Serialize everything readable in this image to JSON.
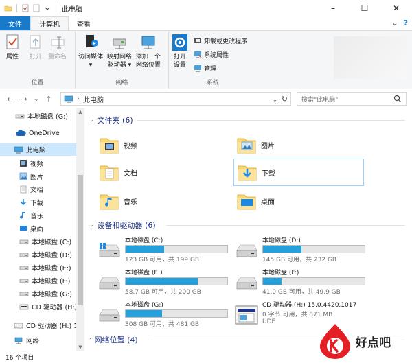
{
  "window": {
    "title": "此电脑"
  },
  "tabs": [
    {
      "label": "文件"
    },
    {
      "label": "计算机"
    },
    {
      "label": "查看"
    }
  ],
  "ribbon": {
    "location": {
      "label": "位置",
      "properties": "属性",
      "open": "打开",
      "rename": "重命名"
    },
    "network": {
      "label": "网络",
      "access_media_1": "访问媒体",
      "access_media_2": "",
      "map_drive_1": "映射网络",
      "map_drive_2": "驱动器",
      "add_location_1": "添加一个",
      "add_location_2": "网络位置"
    },
    "system": {
      "label": "系统",
      "open_settings_1": "打开",
      "open_settings_2": "设置",
      "uninstall": "卸载或更改程序",
      "sys_props": "系统属性",
      "manage": "管理"
    }
  },
  "address": {
    "path": "此电脑",
    "search_placeholder": "搜索\"此电脑\""
  },
  "nav": {
    "items": [
      {
        "label": "本地磁盘 (G:)",
        "icon": "drive-icon"
      },
      {
        "label": "OneDrive",
        "icon": "cloud-icon"
      },
      {
        "label": "此电脑",
        "icon": "computer-icon"
      },
      {
        "label": "视频",
        "icon": "video-icon"
      },
      {
        "label": "图片",
        "icon": "pictures-icon"
      },
      {
        "label": "文档",
        "icon": "document-icon"
      },
      {
        "label": "下载",
        "icon": "download-icon"
      },
      {
        "label": "音乐",
        "icon": "music-icon"
      },
      {
        "label": "桌面",
        "icon": "desktop-icon"
      },
      {
        "label": "本地磁盘 (C:)",
        "icon": "drive-icon"
      },
      {
        "label": "本地磁盘 (D:)",
        "icon": "drive-icon"
      },
      {
        "label": "本地磁盘 (E:)",
        "icon": "drive-icon"
      },
      {
        "label": "本地磁盘 (F:)",
        "icon": "drive-icon"
      },
      {
        "label": "本地磁盘 (G:)",
        "icon": "drive-icon"
      },
      {
        "label": "CD 驱动器 (H:)",
        "icon": "cd-icon"
      },
      {
        "label": "CD 驱动器 (H:) 1!",
        "icon": "cd-icon"
      },
      {
        "label": "网络",
        "icon": "network-icon"
      }
    ]
  },
  "content": {
    "folders_header": "文件夹 (6)",
    "folders": [
      {
        "label": "视频"
      },
      {
        "label": "图片"
      },
      {
        "label": "文档"
      },
      {
        "label": "下载"
      },
      {
        "label": "音乐"
      },
      {
        "label": "桌面"
      }
    ],
    "drives_header": "设备和驱动器 (6)",
    "drives": [
      {
        "name": "本地磁盘 (C:)",
        "info": "123 GB 可用，共 199 GB",
        "used_fraction": 0.38
      },
      {
        "name": "本地磁盘 (D:)",
        "info": "145 GB 可用，共 232 GB",
        "used_fraction": 0.38
      },
      {
        "name": "本地磁盘 (E:)",
        "info": "58.7 GB 可用，共 200 GB",
        "used_fraction": 0.71
      },
      {
        "name": "本地磁盘 (F:)",
        "info": "41.0 GB 可用，共 49.9 GB",
        "used_fraction": 0.18
      },
      {
        "name": "本地磁盘 (G:)",
        "info": "308 GB 可用，共 481 GB",
        "used_fraction": 0.36
      },
      {
        "name": "CD 驱动器 (H:) 15.0.4420.1017",
        "info": "0 字节 可用，共 871 MB",
        "info2": "UDF",
        "used_fraction": 1.0
      }
    ],
    "network_header": "网络位置 (4)"
  },
  "status": {
    "count": "16 个项目"
  },
  "watermark": {
    "text": "好点吧"
  },
  "colors": {
    "accent": "#1979ca",
    "bar": "#26a0da",
    "header": "#1e3287",
    "selected": "#cce8ff"
  }
}
